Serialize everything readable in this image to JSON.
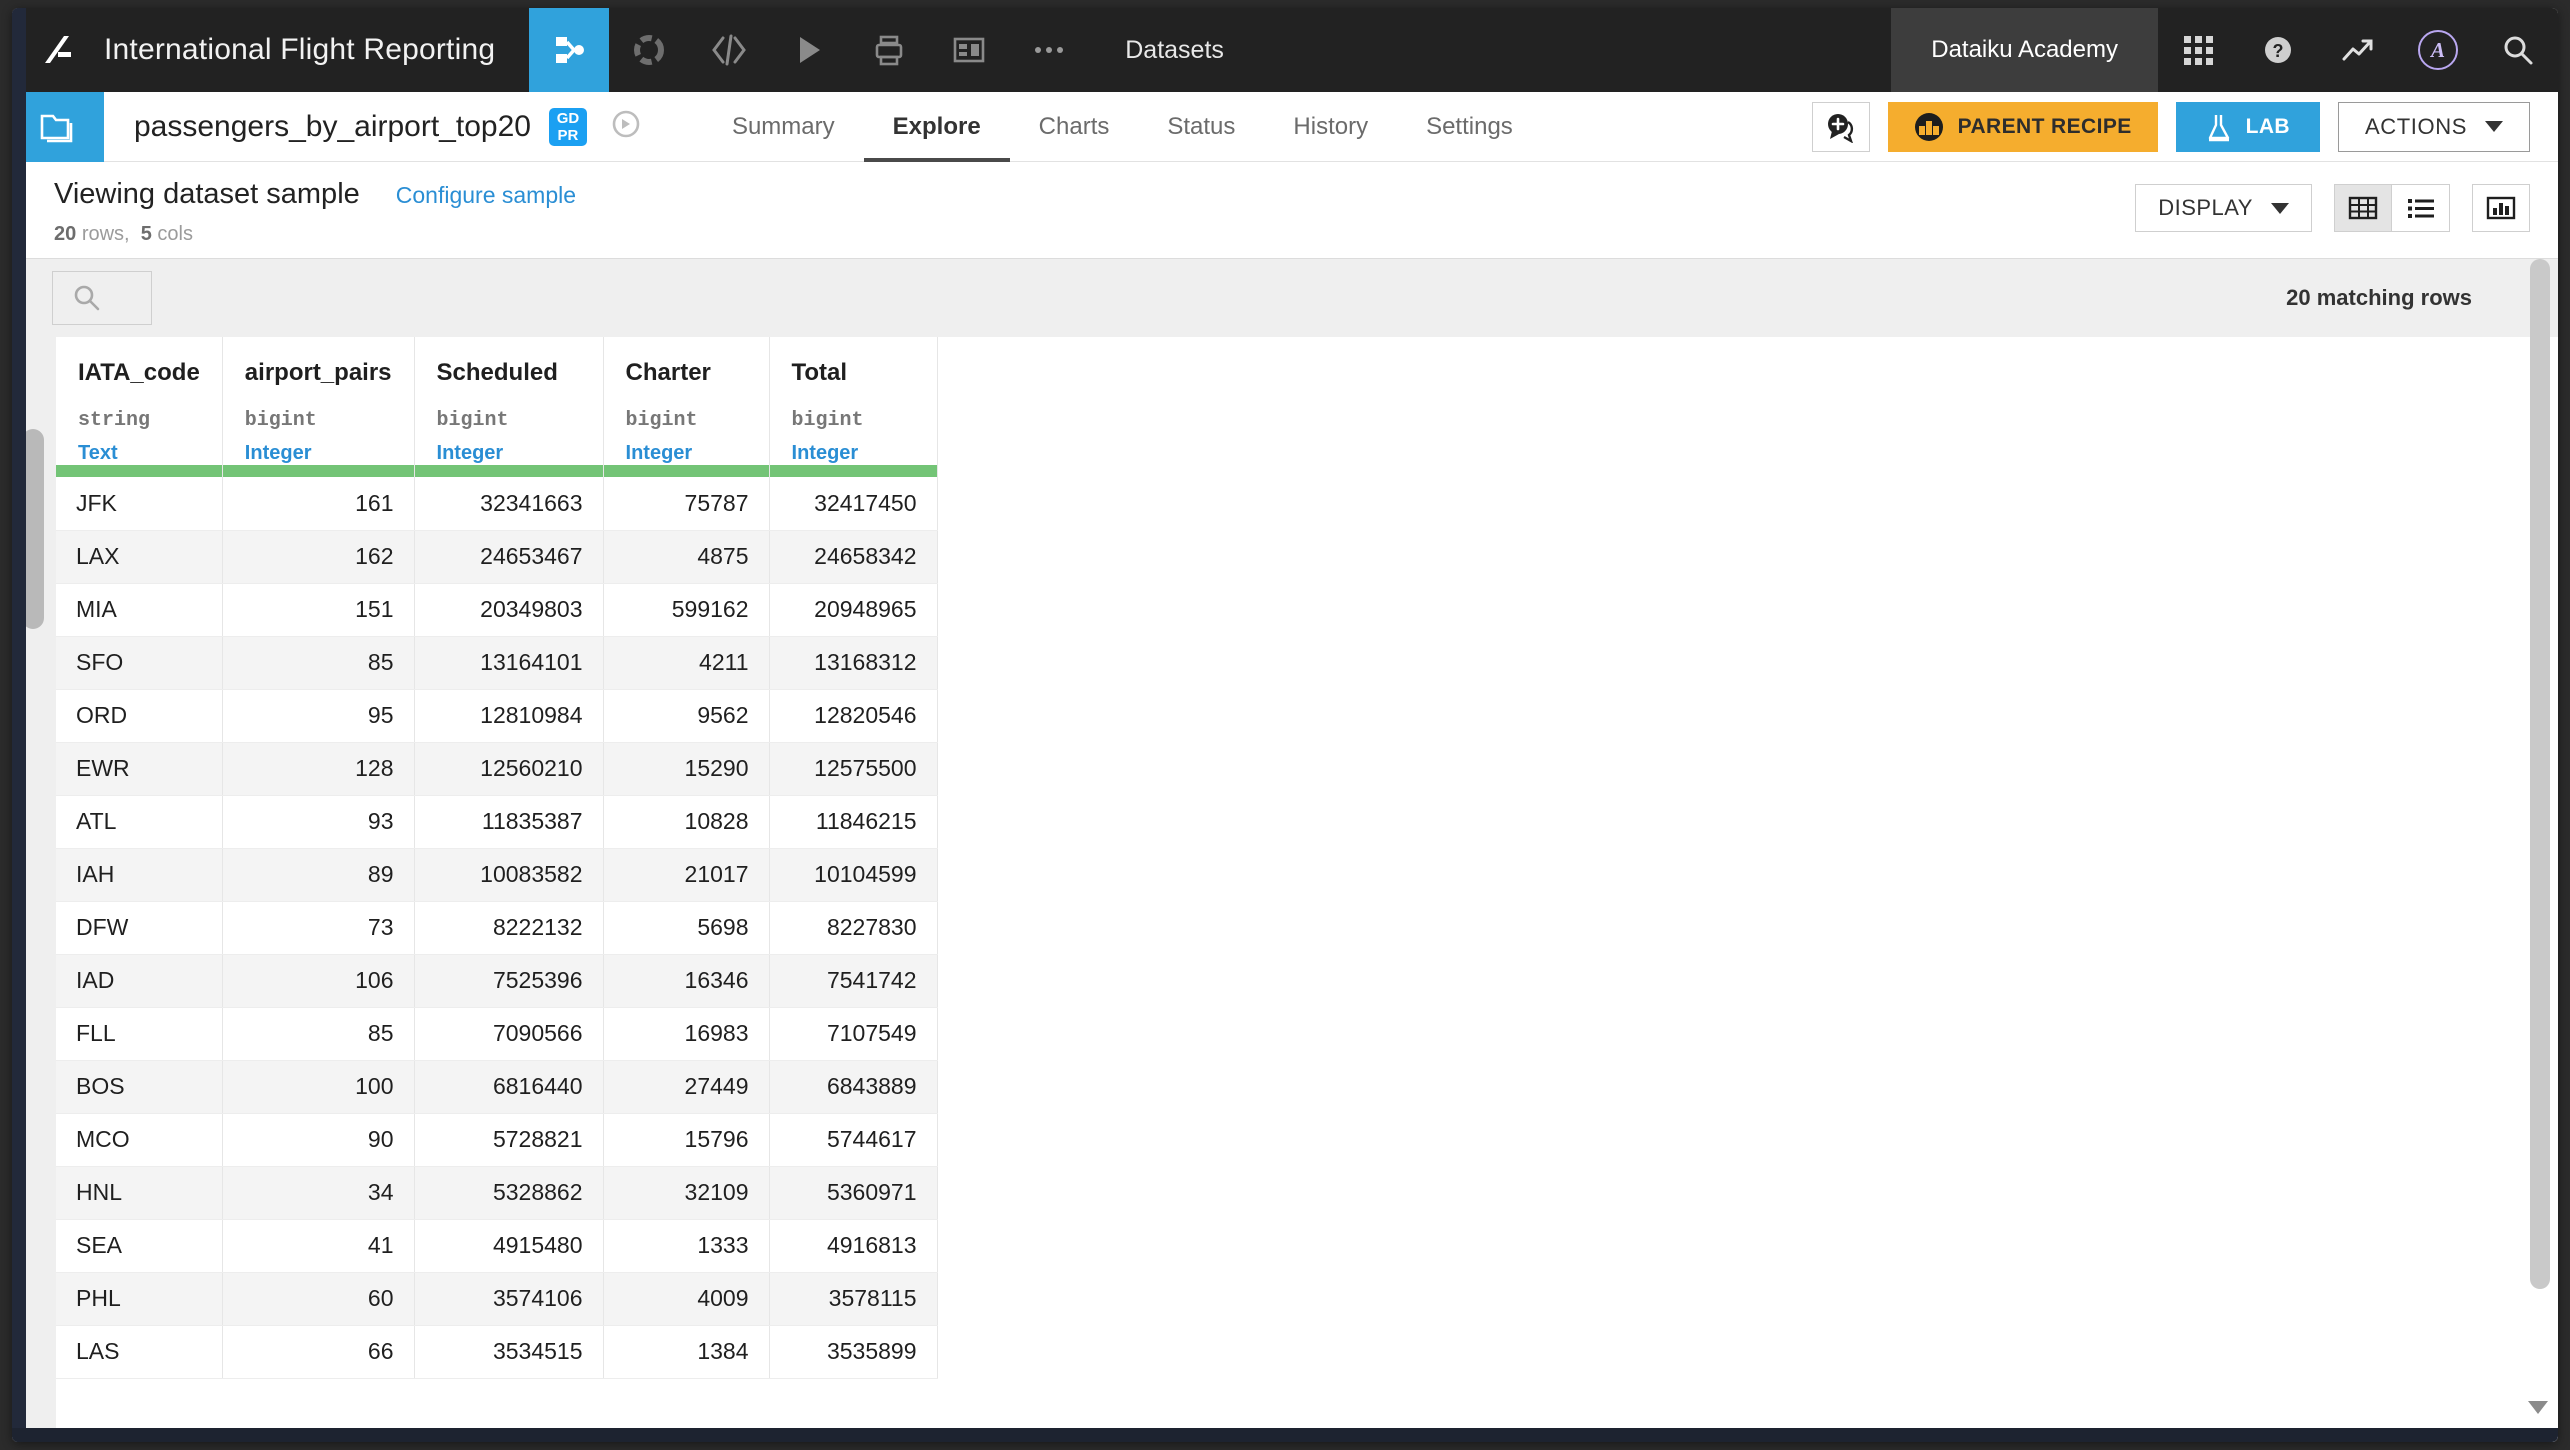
{
  "topbar": {
    "project_title": "International Flight Reporting",
    "logo_icon": "dataiku-bird-logo-icon",
    "nav_items": [
      {
        "name": "flow-icon",
        "active": true
      },
      {
        "name": "lab-wheel-icon",
        "active": false
      },
      {
        "name": "code-icon",
        "active": false
      },
      {
        "name": "play-icon",
        "active": false
      },
      {
        "name": "printer-icon",
        "active": false
      },
      {
        "name": "dashboard-icon",
        "active": false
      },
      {
        "name": "more-ellipsis-icon",
        "active": false
      }
    ],
    "datasets_label": "Datasets",
    "academy_label": "Dataiku Academy",
    "right_icons": [
      "apps-grid-icon",
      "help-icon",
      "trending-icon",
      "user-avatar",
      "search-icon"
    ],
    "avatar_letter": "A"
  },
  "dataset": {
    "icon": "dataset-folder-icon",
    "name": "passengers_by_airport_top20",
    "gdpr_top": "GD",
    "gdpr_bottom": "PR",
    "compass_icon": "compass-icon",
    "tabs": [
      {
        "label": "Summary",
        "active": false
      },
      {
        "label": "Explore",
        "active": true
      },
      {
        "label": "Charts",
        "active": false
      },
      {
        "label": "Status",
        "active": false
      },
      {
        "label": "History",
        "active": false
      },
      {
        "label": "Settings",
        "active": false
      }
    ],
    "discussion_icon": "discussion-add-icon",
    "parent_recipe_label": "PARENT RECIPE",
    "lab_label": "LAB",
    "actions_label": "ACTIONS"
  },
  "sample": {
    "title": "Viewing dataset sample",
    "configure_link": "Configure sample",
    "rows_count": "20",
    "rows_word": "rows,",
    "cols_count": "5",
    "cols_word": "cols",
    "display_label": "DISPLAY",
    "view_toggles": [
      "table-view-icon",
      "list-view-icon"
    ],
    "chart_icon": "chart-view-icon"
  },
  "table": {
    "search_placeholder": "",
    "search_value": "",
    "matching_rows": "20 matching rows",
    "columns": [
      {
        "name": "IATA_code",
        "type": "string",
        "meaning": "Text",
        "align": "left"
      },
      {
        "name": "airport_pairs",
        "type": "bigint",
        "meaning": "Integer",
        "align": "right"
      },
      {
        "name": "Scheduled",
        "type": "bigint",
        "meaning": "Integer",
        "align": "right"
      },
      {
        "name": "Charter",
        "type": "bigint",
        "meaning": "Integer",
        "align": "right"
      },
      {
        "name": "Total",
        "type": "bigint",
        "meaning": "Integer",
        "align": "right"
      }
    ],
    "quality_color": "#73c476",
    "rows": [
      [
        "JFK",
        "161",
        "32341663",
        "75787",
        "32417450"
      ],
      [
        "LAX",
        "162",
        "24653467",
        "4875",
        "24658342"
      ],
      [
        "MIA",
        "151",
        "20349803",
        "599162",
        "20948965"
      ],
      [
        "SFO",
        "85",
        "13164101",
        "4211",
        "13168312"
      ],
      [
        "ORD",
        "95",
        "12810984",
        "9562",
        "12820546"
      ],
      [
        "EWR",
        "128",
        "12560210",
        "15290",
        "12575500"
      ],
      [
        "ATL",
        "93",
        "11835387",
        "10828",
        "11846215"
      ],
      [
        "IAH",
        "89",
        "10083582",
        "21017",
        "10104599"
      ],
      [
        "DFW",
        "73",
        "8222132",
        "5698",
        "8227830"
      ],
      [
        "IAD",
        "106",
        "7525396",
        "16346",
        "7541742"
      ],
      [
        "FLL",
        "85",
        "7090566",
        "16983",
        "7107549"
      ],
      [
        "BOS",
        "100",
        "6816440",
        "27449",
        "6843889"
      ],
      [
        "MCO",
        "90",
        "5728821",
        "15796",
        "5744617"
      ],
      [
        "HNL",
        "34",
        "5328862",
        "32109",
        "5360971"
      ],
      [
        "SEA",
        "41",
        "4915480",
        "1333",
        "4916813"
      ],
      [
        "PHL",
        "60",
        "3574106",
        "4009",
        "3578115"
      ],
      [
        "LAS",
        "66",
        "3534515",
        "1384",
        "3535899"
      ]
    ]
  },
  "colors": {
    "topbar_bg": "#222222",
    "accent_blue": "#30a2dc",
    "recipe_orange": "#f5ad2e",
    "link_blue": "#2a8ed4",
    "quality_green": "#73c476"
  }
}
